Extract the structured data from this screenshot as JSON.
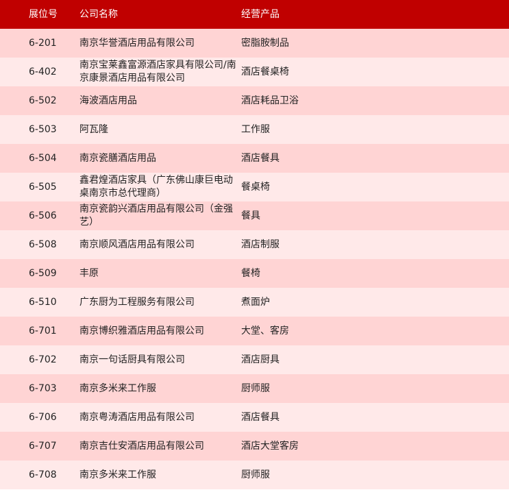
{
  "header": {
    "col_id": "展位号",
    "col_company": "公司名称",
    "col_product": "经营产品"
  },
  "rows": [
    {
      "id": "6-201",
      "company": "南京华誉酒店用品有限公司",
      "product": "密脂胺制品"
    },
    {
      "id": "6-402",
      "company": "南京宝莱鑫富源酒店家具有限公司/南京康景酒店用品有限公司",
      "product": "酒店餐桌椅"
    },
    {
      "id": "6-502",
      "company": "海波酒店用品",
      "product": "酒店耗品卫浴"
    },
    {
      "id": "6-503",
      "company": "阿瓦隆",
      "product": "工作服"
    },
    {
      "id": "6-504",
      "company": "南京瓷膳酒店用品",
      "product": "酒店餐具"
    },
    {
      "id": "6-505",
      "company": "鑫君煌酒店家具（广东佛山康巨电动桌南京市总代理商）",
      "product": "餐桌椅"
    },
    {
      "id": "6-506",
      "company": "南京瓷韵兴酒店用品有限公司（金强艺）",
      "product": "餐具"
    },
    {
      "id": "6-508",
      "company": "南京顺风酒店用品有限公司",
      "product": "酒店制服"
    },
    {
      "id": "6-509",
      "company": "丰原",
      "product": "餐椅"
    },
    {
      "id": "6-510",
      "company": "广东厨为工程服务有限公司",
      "product": "煮面炉"
    },
    {
      "id": "6-701",
      "company": "南京博织雅酒店用品有限公司",
      "product": "大堂、客房"
    },
    {
      "id": "6-702",
      "company": "南京一句话厨具有限公司",
      "product": "酒店厨具"
    },
    {
      "id": "6-703",
      "company": "南京多米来工作服",
      "product": "厨师服"
    },
    {
      "id": "6-706",
      "company": "南京粤涛酒店用品有限公司",
      "product": "酒店餐具"
    },
    {
      "id": "6-707",
      "company": "南京吉仕安酒店用品有限公司",
      "product": "酒店大堂客房"
    },
    {
      "id": "6-708",
      "company": "南京多米来工作服",
      "product": "厨师服"
    }
  ],
  "colors": {
    "header_bg": "#c00000",
    "row_odd": "#ffd4d4",
    "row_even": "#ffe9e9"
  }
}
